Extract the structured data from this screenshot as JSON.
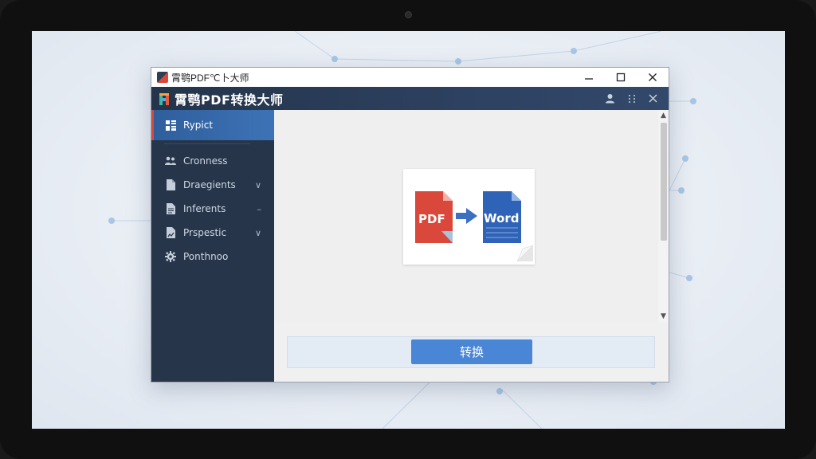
{
  "window": {
    "title": "霄鹗PDF℃卜大师",
    "controls": [
      "minimize",
      "maximize",
      "close"
    ]
  },
  "app": {
    "name": "霄鹗PDF转换大师"
  },
  "sidebar": {
    "items": [
      {
        "label": "Rypict",
        "icon": "grid-icon",
        "active": true,
        "chevron": ""
      },
      {
        "label": "Cronness",
        "icon": "users-icon",
        "active": false,
        "chevron": ""
      },
      {
        "label": "Draegients",
        "icon": "document-icon",
        "active": false,
        "chevron": "∨"
      },
      {
        "label": "Inferents",
        "icon": "file-text-icon",
        "active": false,
        "chevron": "–"
      },
      {
        "label": "Prspestic",
        "icon": "file-chart-icon",
        "active": false,
        "chevron": "∨"
      },
      {
        "label": "Ponthnoo",
        "icon": "gear-icon",
        "active": false,
        "chevron": ""
      }
    ]
  },
  "preview": {
    "source_label": "PDF",
    "target_label": "Word"
  },
  "actions": {
    "convert_label": "转换"
  },
  "colors": {
    "sidebar_bg": "#26354a",
    "active_item": "#3d73b6",
    "accent_red": "#d24a3d",
    "convert_button": "#4a86d6",
    "pdf_red": "#d9483b",
    "word_blue": "#2f63b8"
  }
}
